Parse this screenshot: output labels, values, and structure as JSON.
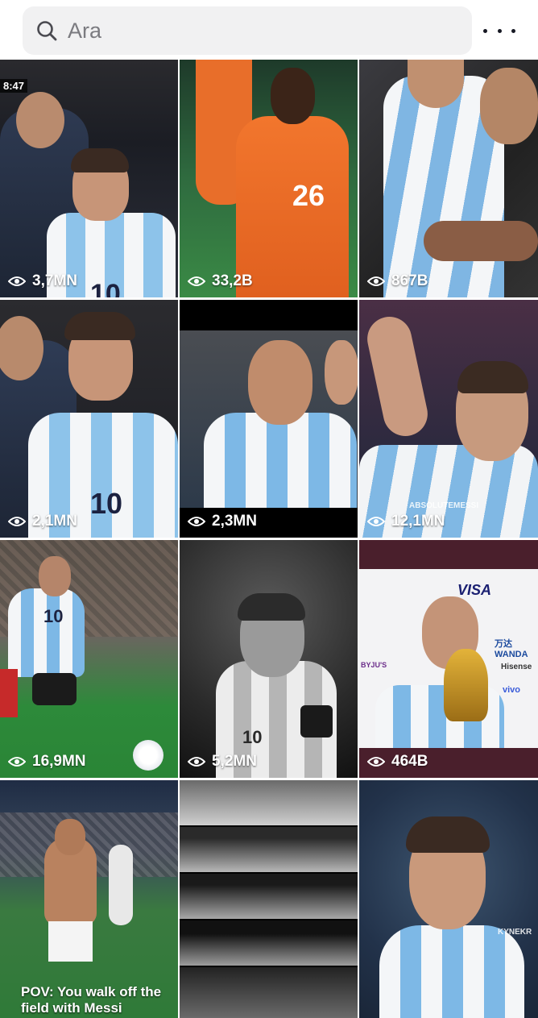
{
  "search": {
    "placeholder": "Ara"
  },
  "icons": {
    "search": "search-icon",
    "more": "more-icon",
    "views": "eye-icon"
  },
  "colors": {
    "search_bg": "#f1f1f2",
    "placeholder": "#7b7b80",
    "more_dots": "#161823"
  },
  "videos": [
    {
      "views": "3,7MN",
      "overlay_text": "8:47",
      "jersey_number": "10"
    },
    {
      "views": "33,2B",
      "jersey_number": "26"
    },
    {
      "views": "867B"
    },
    {
      "views": "2,1MN",
      "jersey_number": "10"
    },
    {
      "views": "2,3MN"
    },
    {
      "views": "12,1MN",
      "watermark": "ABSOLUTEMESSI"
    },
    {
      "views": "16,9MN",
      "jersey_number": "10"
    },
    {
      "views": "5,2MN",
      "jersey_number": "10"
    },
    {
      "views": "464B",
      "sponsors": [
        "VISA",
        "万达 WANDA",
        "BYJU'S",
        "Hisense",
        "vivo"
      ]
    },
    {
      "caption": "POV: You walk off the field with Messi"
    },
    {},
    {
      "watermark": "KYNEKR"
    }
  ]
}
